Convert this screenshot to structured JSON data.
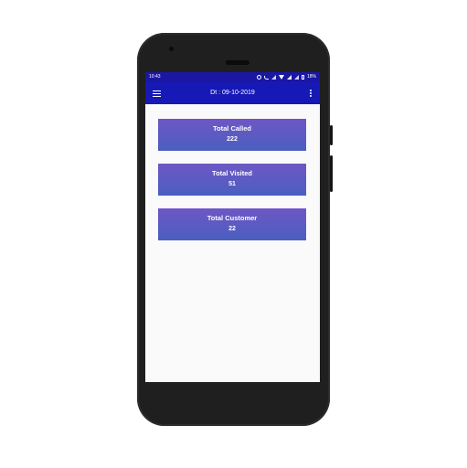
{
  "status_bar": {
    "time": "10:43",
    "battery": "18%"
  },
  "app_bar": {
    "title": "Dt : 09-10-2019",
    "menu_icon": "hamburger-menu-icon",
    "more_icon": "more-vert-icon"
  },
  "cards": [
    {
      "title": "Total Called",
      "value": "222"
    },
    {
      "title": "Total Visited",
      "value": "51"
    },
    {
      "title": "Total Customer",
      "value": "22"
    }
  ],
  "colors": {
    "status_bar": "#1a17a3",
    "app_bar": "#1619b5",
    "card_gradient_top": "#6e57c4",
    "card_gradient_bottom": "#4a5fc0"
  }
}
